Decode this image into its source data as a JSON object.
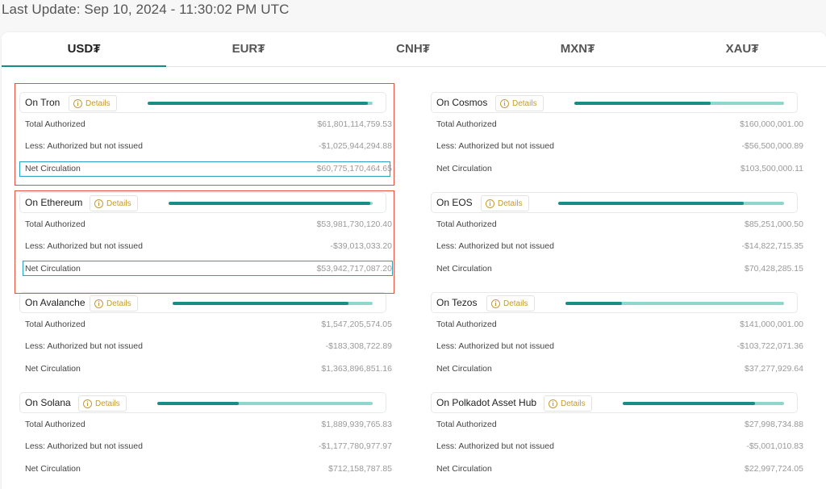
{
  "header": {
    "last_update": "Last Update: Sep 10, 2024 - 11:30:02 PM UTC"
  },
  "tabs": [
    {
      "label": "USD₮",
      "active": true
    },
    {
      "label": "EUR₮",
      "active": false
    },
    {
      "label": "CNH₮",
      "active": false
    },
    {
      "label": "MXN₮",
      "active": false
    },
    {
      "label": "XAU₮",
      "active": false
    }
  ],
  "labels": {
    "details": "Details",
    "total_authorized": "Total Authorized",
    "less_not_issued": "Less: Authorized but not issued",
    "net_circulation": "Net Circulation"
  },
  "colors": {
    "accent": "#1b8a85",
    "bar_fill": "#178d86",
    "bar_track": "#8fd7cc",
    "details": "#c79a2c",
    "highlight_red": "#e8523d",
    "highlight_blue": "#2a9fc4"
  },
  "chains": [
    {
      "name": "On Tron",
      "total_authorized": "$61,801,114,759.53",
      "less_not_issued": "-$1,025,944,294.88",
      "net_circulation": "$60,775,170,464.65",
      "circulating_ratio": 0.98
    },
    {
      "name": "On Cosmos",
      "total_authorized": "$160,000,001.00",
      "less_not_issued": "-$56,500,000.89",
      "net_circulation": "$103,500,000.11",
      "circulating_ratio": 0.65
    },
    {
      "name": "On Ethereum",
      "total_authorized": "$53,981,730,120.40",
      "less_not_issued": "-$39,013,033.20",
      "net_circulation": "$53,942,717,087.20",
      "circulating_ratio": 0.99
    },
    {
      "name": "On EOS",
      "total_authorized": "$85,251,000.50",
      "less_not_issued": "-$14,822,715.35",
      "net_circulation": "$70,428,285.15",
      "circulating_ratio": 0.82
    },
    {
      "name": "On Avalanche",
      "total_authorized": "$1,547,205,574.05",
      "less_not_issued": "-$183,308,722.89",
      "net_circulation": "$1,363,896,851.16",
      "circulating_ratio": 0.88
    },
    {
      "name": "On Tezos",
      "total_authorized": "$141,000,001.00",
      "less_not_issued": "-$103,722,071.36",
      "net_circulation": "$37,277,929.64",
      "circulating_ratio": 0.26
    },
    {
      "name": "On Solana",
      "total_authorized": "$1,889,939,765.83",
      "less_not_issued": "-$1,177,780,977.97",
      "net_circulation": "$712,158,787.85",
      "circulating_ratio": 0.38
    },
    {
      "name": "On Polkadot Asset Hub",
      "total_authorized": "$27,998,734.88",
      "less_not_issued": "-$5,001,010.83",
      "net_circulation": "$22,997,724.05",
      "circulating_ratio": 0.82
    }
  ]
}
